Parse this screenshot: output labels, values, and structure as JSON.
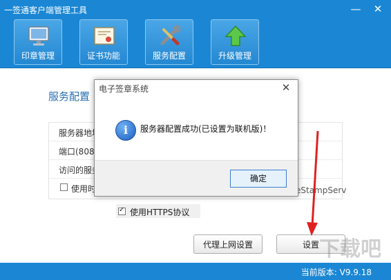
{
  "window": {
    "title": "一签通客户端管理工具",
    "minimize": "—",
    "close": "✕"
  },
  "toolbar": {
    "items": [
      {
        "label": "印章管理",
        "icon": "monitor-icon"
      },
      {
        "label": "证书功能",
        "icon": "certificate-icon"
      },
      {
        "label": "服务配置",
        "icon": "tools-icon"
      },
      {
        "label": "升级管理",
        "icon": "upgrade-arrow-icon"
      }
    ]
  },
  "main": {
    "section_title": "服务配置",
    "rows": [
      {
        "label": "服务器地址"
      },
      {
        "label": "端口(8080"
      },
      {
        "label": "访问的服务"
      },
      {
        "label": "使用时"
      }
    ],
    "overflow_text": "eStampServ",
    "https_label": "使用HTTPS协议",
    "https_checked": true,
    "proxy_button": "代理上网设置",
    "settings_button": "设置"
  },
  "status": {
    "version": "当前版本: V9.9.18"
  },
  "dialog": {
    "title": "电子签章系统",
    "close": "✕",
    "message": "服务器配置成功(已设置为联机版)！",
    "ok_button": "确定"
  },
  "colors": {
    "header_blue": "#1b87d4",
    "section_title": "#2a6fb3",
    "annotation_red": "#e02020"
  }
}
